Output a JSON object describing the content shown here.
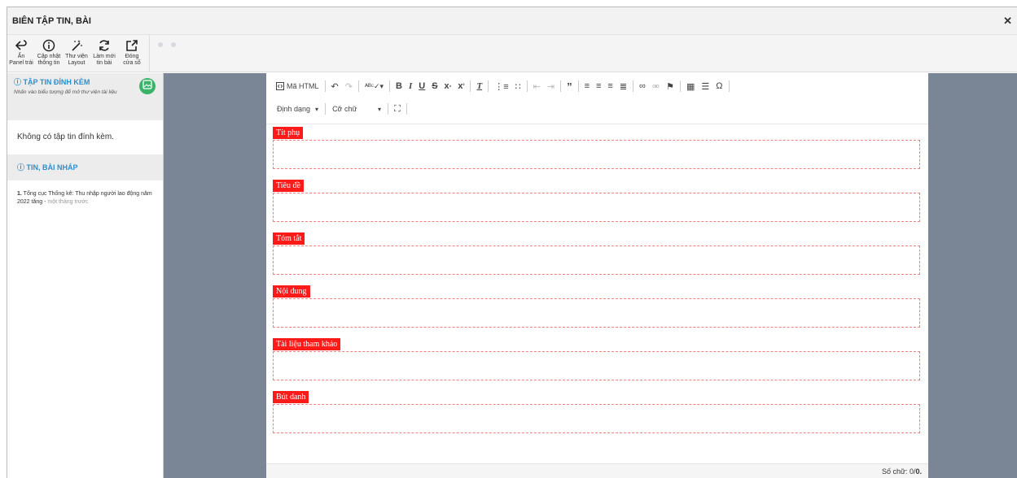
{
  "window": {
    "title": "BIÊN TẬP TIN, BÀI",
    "close": "✕"
  },
  "toolbar": {
    "buttons": [
      {
        "label": "Ẩn\nPanel trái",
        "icon": "collapse-left-icon"
      },
      {
        "label": "Cập nhật\nthông tin",
        "icon": "info-icon"
      },
      {
        "label": "Thư viện\nLayout",
        "icon": "magic-wand-icon"
      },
      {
        "label": "Làm mới\ntin bài",
        "icon": "refresh-icon"
      },
      {
        "label": "Đóng\ncửa sổ",
        "icon": "external-close-icon"
      }
    ]
  },
  "left": {
    "attach_title": "ⓘ TẬP TIN ĐÍNH KÈM",
    "attach_hint": "Nhấn vào biểu tượng để mở thư viện tài liệu",
    "no_attach": "Không có tập tin đính kèm.",
    "draft_title": "ⓘ TIN, BÀI NHÁP",
    "drafts": [
      {
        "num": "1.",
        "text": "Tổng cục Thống kê: Thu nhập người lao động năm 2022 tăng -",
        "time": "một tháng trước"
      }
    ]
  },
  "editor": {
    "html_label": "Mã HTML",
    "format_label": "Định dạng",
    "size_label": "Cỡ chữ",
    "fields": [
      "Tít phụ",
      "Tiêu đề",
      "Tóm tắt",
      "Nội dung",
      "Tài liệu tham khảo",
      "Bút danh"
    ],
    "status_prefix": "Số chữ: 0/",
    "status_count": "0."
  }
}
